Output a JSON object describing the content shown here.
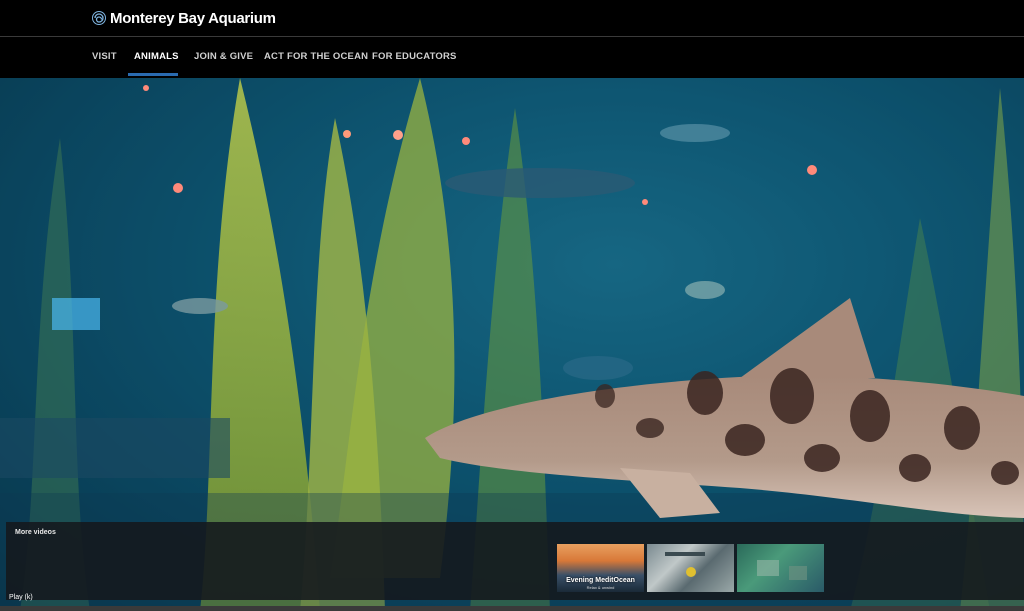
{
  "header": {
    "brand_name": "Monterey Bay Aquarium",
    "logo_icon": "spiral-logo-icon"
  },
  "nav": {
    "items": [
      {
        "label": "VISIT"
      },
      {
        "label": "ANIMALS"
      },
      {
        "label": "JOIN & GIVE"
      },
      {
        "label": "ACT FOR THE OCEAN"
      },
      {
        "label": "FOR EDUCATORS"
      }
    ],
    "active": "ANIMALS"
  },
  "player": {
    "more_videos_label": "More videos",
    "play_label": "Play (k)",
    "thumbnails": [
      {
        "title": "Evening MeditOcean",
        "subtitle": "Relax & unwind"
      },
      {
        "title": ""
      },
      {
        "title": ""
      }
    ]
  },
  "colors": {
    "nav_active_underline": "#2a6bb0",
    "header_bg": "#000000"
  }
}
